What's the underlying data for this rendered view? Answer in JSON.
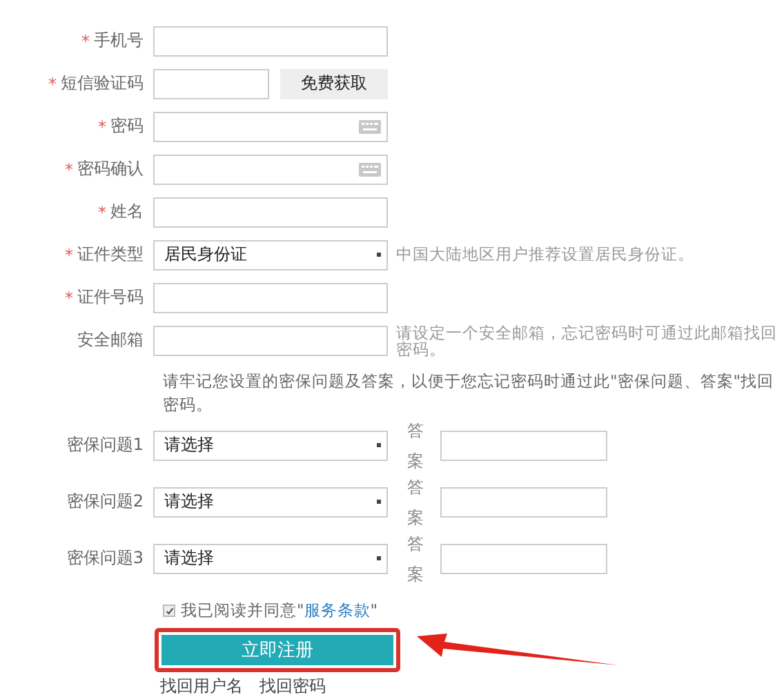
{
  "fields": [
    {
      "kind": "text",
      "marker": "*",
      "label": "手机号"
    },
    {
      "kind": "sms",
      "marker": "*",
      "label": "短信验证码",
      "button": "免费获取"
    },
    {
      "kind": "password",
      "marker": "*",
      "label": "密码"
    },
    {
      "kind": "password",
      "marker": "*",
      "label": "密码确认"
    },
    {
      "kind": "text",
      "marker": "*",
      "label": "姓名"
    },
    {
      "kind": "select",
      "marker": "*",
      "label": "证件类型",
      "value": "居民身份证",
      "hint": "中国大陆地区用户推荐设置居民身份证。"
    },
    {
      "kind": "text",
      "marker": "*",
      "label": "证件号码"
    },
    {
      "kind": "text",
      "label": "安全邮箱",
      "hint": "请设定一个安全邮箱，忘记密码时可通过此邮箱找回密码。"
    }
  ],
  "notice": "请牢记您设置的密保问题及答案，以便于您忘记密码时通过此\"密保问题、答案\"找回密码。",
  "questions": [
    {
      "label": "密保问题1",
      "value": "请选择",
      "answer_label": "答案"
    },
    {
      "label": "密保问题2",
      "value": "请选择",
      "answer_label": "答案"
    },
    {
      "label": "密保问题3",
      "value": "请选择",
      "answer_label": "答案"
    }
  ],
  "agreement": {
    "checked": true,
    "text": "我已阅读并同意\"",
    "link": "服务条款",
    "after": "\""
  },
  "submit": "立即注册",
  "links": [
    "找回用户名",
    "找回密码"
  ]
}
